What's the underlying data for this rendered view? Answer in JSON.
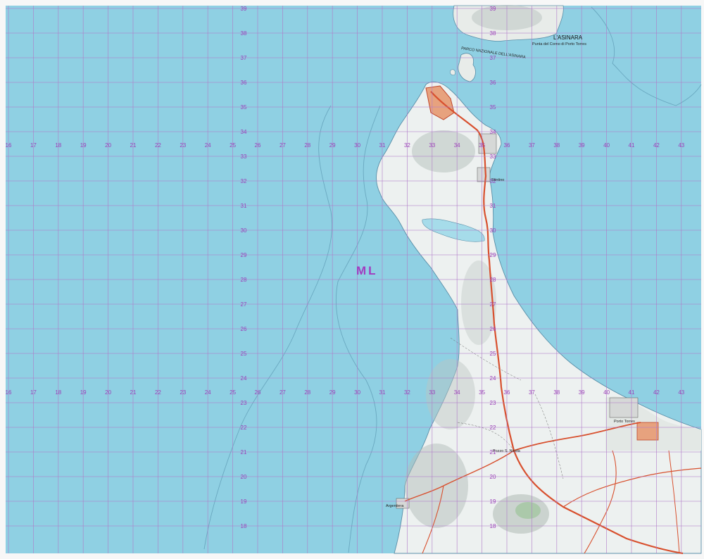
{
  "map": {
    "zone_label": "ML",
    "colors": {
      "sea": "#8fd0e3",
      "land": "#edf1f0",
      "road": "#d8502e",
      "grid": "#b07ac8",
      "grid_label": "#9b3fb8"
    },
    "easting_labels": [
      "16",
      "17",
      "18",
      "19",
      "20",
      "21",
      "22",
      "23",
      "24",
      "25",
      "26",
      "27",
      "28",
      "29",
      "30",
      "31",
      "32",
      "33",
      "34",
      "35",
      "36",
      "37",
      "38",
      "39",
      "40",
      "41",
      "42",
      "43"
    ],
    "northing_labels": [
      "39",
      "38",
      "37",
      "36",
      "35",
      "34",
      "33",
      "32",
      "31",
      "30",
      "29",
      "28",
      "27",
      "26",
      "25",
      "24",
      "23",
      "22",
      "21",
      "20",
      "19",
      "18"
    ],
    "places": {
      "asinara": "L'ASINARA",
      "asinara_sub": "Punta del Corno di Porto Torres",
      "stintino": "Stintino",
      "parco": "PARCO NAZIONALE DELL'ASINARA",
      "porto_torres": "Porto Torres",
      "pozzo": "Pozzo S. Nicola",
      "argentiera": "Argentiera"
    }
  }
}
